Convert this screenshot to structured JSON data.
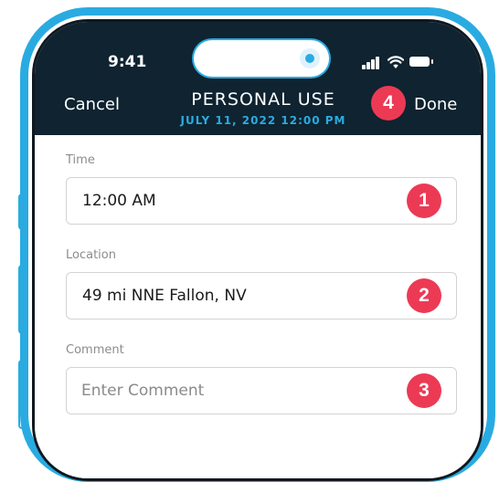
{
  "status_bar": {
    "time": "9:41",
    "icons": [
      "cellular-signal-icon",
      "wifi-icon",
      "battery-icon"
    ]
  },
  "header": {
    "cancel_label": "Cancel",
    "title": "PERSONAL USE",
    "subtitle": "JULY 11, 2022 12:00 PM",
    "done_label": "Done",
    "done_badge": "4"
  },
  "form": {
    "time": {
      "label": "Time",
      "value": "12:00 AM",
      "badge": "1"
    },
    "location": {
      "label": "Location",
      "value": "49 mi NNE Fallon, NV",
      "badge": "2"
    },
    "comment": {
      "label": "Comment",
      "value": "",
      "placeholder": "Enter Comment",
      "badge": "3"
    }
  },
  "colors": {
    "accent": "#29abe2",
    "header_bg": "#0f2330",
    "badge": "#ec3a55"
  }
}
